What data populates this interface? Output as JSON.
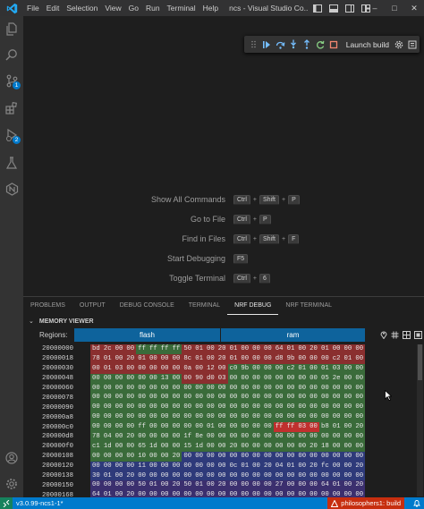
{
  "titlebar": {
    "menu": [
      "File",
      "Edit",
      "Selection",
      "View",
      "Go",
      "Run",
      "Terminal",
      "Help"
    ],
    "title": "ncs - Visual Studio Co...",
    "window_controls": [
      "minimize-icon",
      "maximize-icon",
      "close-icon"
    ]
  },
  "activity_bar": {
    "items": [
      {
        "name": "explorer",
        "icon": "files-icon"
      },
      {
        "name": "search",
        "icon": "search-icon"
      },
      {
        "name": "source-control",
        "icon": "source-control-icon",
        "badge": "1"
      },
      {
        "name": "extensions",
        "icon": "extensions-icon"
      },
      {
        "name": "run-debug",
        "icon": "run-debug-icon",
        "badge": "2"
      },
      {
        "name": "testing",
        "icon": "flask-icon"
      },
      {
        "name": "nrf-connect",
        "icon": "nrf-connect-icon"
      }
    ],
    "bottom": [
      {
        "name": "accounts",
        "icon": "account-icon"
      },
      {
        "name": "manage",
        "icon": "gear-icon"
      }
    ]
  },
  "debug_toolbar": {
    "buttons": [
      "continue-icon",
      "step-over-icon",
      "step-into-icon",
      "step-out-icon",
      "restart-icon",
      "stop-icon"
    ],
    "launch_config": "Launch build",
    "config_action_icons": [
      "gear-icon",
      "more-icon"
    ]
  },
  "shortcuts": [
    {
      "label": "Show All Commands",
      "keys": [
        "Ctrl",
        "Shift",
        "P"
      ]
    },
    {
      "label": "Go to File",
      "keys": [
        "Ctrl",
        "P"
      ]
    },
    {
      "label": "Find in Files",
      "keys": [
        "Ctrl",
        "Shift",
        "F"
      ]
    },
    {
      "label": "Start Debugging",
      "keys": [
        "F5"
      ]
    },
    {
      "label": "Toggle Terminal",
      "keys": [
        "Ctrl",
        "6"
      ]
    }
  ],
  "panel": {
    "tabs": [
      "PROBLEMS",
      "OUTPUT",
      "DEBUG CONSOLE",
      "TERMINAL",
      "NRF DEBUG",
      "NRF TERMINAL"
    ],
    "active_tab": "NRF DEBUG",
    "section_title": "MEMORY VIEWER",
    "regions_label": "Regions:",
    "regions": [
      "flash",
      "ram"
    ],
    "active_region": "ram"
  },
  "memory": {
    "rows": [
      {
        "addr": "20000000",
        "bytes": [
          "bd",
          "2c",
          "00",
          "00",
          "ff",
          "ff",
          "ff",
          "ff",
          "50",
          "01",
          "00",
          "20",
          "01",
          "00",
          "00",
          "00",
          "64",
          "01",
          "00",
          "20",
          "01",
          "00",
          "00",
          "00"
        ],
        "colors": "rrrrggggrrrrrrrrrrrrrrrr"
      },
      {
        "addr": "20000018",
        "bytes": [
          "78",
          "01",
          "00",
          "20",
          "01",
          "00",
          "00",
          "00",
          "8c",
          "01",
          "00",
          "20",
          "01",
          "00",
          "00",
          "00",
          "d8",
          "9b",
          "00",
          "00",
          "00",
          "c2",
          "01",
          "00"
        ],
        "colors": "rrrrrrrrrrrrrrrrrrrrrrrr"
      },
      {
        "addr": "20000030",
        "bytes": [
          "00",
          "01",
          "03",
          "00",
          "00",
          "00",
          "00",
          "00",
          "0a",
          "00",
          "12",
          "00",
          "c0",
          "9b",
          "00",
          "00",
          "00",
          "c2",
          "01",
          "00",
          "01",
          "03",
          "00",
          "00"
        ],
        "colors": "rrrrrrrrrrrrgggggggggggg"
      },
      {
        "addr": "20000048",
        "bytes": [
          "00",
          "00",
          "00",
          "00",
          "00",
          "00",
          "13",
          "00",
          "00",
          "90",
          "d0",
          "03",
          "00",
          "00",
          "00",
          "00",
          "00",
          "00",
          "00",
          "00",
          "05",
          "2e",
          "00",
          "00"
        ],
        "colors": "ggggggggrrrrgggggggggggg"
      },
      {
        "addr": "20000060",
        "bytes": [
          "00",
          "00",
          "00",
          "00",
          "00",
          "00",
          "00",
          "00",
          "00",
          "00",
          "00",
          "00",
          "00",
          "00",
          "00",
          "00",
          "00",
          "00",
          "00",
          "00",
          "00",
          "00",
          "00",
          "00"
        ],
        "colors": "gggggggggggggggggggggggg"
      },
      {
        "addr": "20000078",
        "bytes": [
          "00",
          "00",
          "00",
          "00",
          "00",
          "00",
          "00",
          "00",
          "00",
          "00",
          "00",
          "00",
          "00",
          "00",
          "00",
          "00",
          "00",
          "00",
          "00",
          "00",
          "00",
          "00",
          "00",
          "00"
        ],
        "colors": "gggggggggggggggggggggggg"
      },
      {
        "addr": "20000090",
        "bytes": [
          "00",
          "00",
          "00",
          "00",
          "00",
          "00",
          "00",
          "00",
          "00",
          "00",
          "00",
          "00",
          "00",
          "00",
          "00",
          "00",
          "00",
          "00",
          "00",
          "00",
          "00",
          "00",
          "00",
          "00"
        ],
        "colors": "gggggggggggggggggggggggg"
      },
      {
        "addr": "200000a8",
        "bytes": [
          "00",
          "00",
          "00",
          "00",
          "00",
          "00",
          "00",
          "00",
          "00",
          "00",
          "00",
          "00",
          "00",
          "00",
          "00",
          "00",
          "00",
          "00",
          "00",
          "00",
          "00",
          "00",
          "00",
          "00"
        ],
        "colors": "gggggggggggggggggggggggg"
      },
      {
        "addr": "200000c0",
        "bytes": [
          "00",
          "00",
          "00",
          "00",
          "ff",
          "00",
          "00",
          "00",
          "00",
          "00",
          "01",
          "00",
          "00",
          "00",
          "00",
          "00",
          "ff",
          "ff",
          "03",
          "00",
          "b8",
          "01",
          "00",
          "20"
        ],
        "colors": "gggggggggggggggghhhhgggg"
      },
      {
        "addr": "200000d8",
        "bytes": [
          "78",
          "04",
          "00",
          "20",
          "00",
          "00",
          "00",
          "00",
          "1f",
          "8e",
          "00",
          "00",
          "00",
          "00",
          "00",
          "00",
          "00",
          "00",
          "00",
          "00",
          "00",
          "00",
          "00",
          "00"
        ],
        "colors": "gggggggggggggggggggggggg"
      },
      {
        "addr": "200000f0",
        "bytes": [
          "c1",
          "1d",
          "00",
          "00",
          "65",
          "1d",
          "00",
          "00",
          "15",
          "1d",
          "00",
          "00",
          "20",
          "00",
          "00",
          "00",
          "00",
          "00",
          "00",
          "20",
          "18",
          "00",
          "00",
          "00"
        ],
        "colors": "gggggggggggggggggggggggg"
      },
      {
        "addr": "20000108",
        "bytes": [
          "00",
          "00",
          "00",
          "00",
          "10",
          "00",
          "00",
          "20",
          "00",
          "00",
          "00",
          "00",
          "00",
          "00",
          "00",
          "00",
          "00",
          "00",
          "00",
          "00",
          "00",
          "00",
          "00",
          "00"
        ],
        "colors": "ggggggggbbbbbbbbbbbbbbbb"
      },
      {
        "addr": "20000120",
        "bytes": [
          "00",
          "00",
          "00",
          "00",
          "11",
          "00",
          "00",
          "00",
          "00",
          "00",
          "00",
          "00",
          "0c",
          "01",
          "00",
          "20",
          "04",
          "01",
          "00",
          "20",
          "fc",
          "00",
          "00",
          "20"
        ],
        "colors": "bbbbbbbbbbbbbbbbbbbbbbbb"
      },
      {
        "addr": "20000138",
        "bytes": [
          "30",
          "01",
          "00",
          "20",
          "00",
          "00",
          "00",
          "00",
          "00",
          "00",
          "00",
          "00",
          "00",
          "00",
          "00",
          "00",
          "00",
          "00",
          "00",
          "00",
          "00",
          "00",
          "00",
          "00"
        ],
        "colors": "bbbbbbbbbbbbbbbbbbbbbbbb"
      },
      {
        "addr": "20000150",
        "bytes": [
          "00",
          "00",
          "00",
          "00",
          "50",
          "01",
          "00",
          "20",
          "50",
          "01",
          "00",
          "20",
          "00",
          "00",
          "00",
          "00",
          "27",
          "00",
          "00",
          "00",
          "64",
          "01",
          "00",
          "20"
        ],
        "colors": "pppppppppppppppppppppppp"
      },
      {
        "addr": "20000168",
        "bytes": [
          "64",
          "01",
          "00",
          "20",
          "00",
          "00",
          "00",
          "00",
          "00",
          "00",
          "00",
          "00",
          "00",
          "00",
          "00",
          "00",
          "00",
          "00",
          "00",
          "00",
          "00",
          "00",
          "00",
          "00"
        ],
        "colors": "pppppppppppppppppppppppp"
      }
    ]
  },
  "status_bar": {
    "version": "v3.0.99-ncs1-1*",
    "build": "philosophers1: build"
  },
  "colors": {
    "accent": "#007acc",
    "region_active": "#0e639c",
    "build_badge": "#c72e0f",
    "mem_red": "#8a2f2f",
    "mem_green": "#3a6b3a",
    "mem_blue": "#2e3a7a",
    "mem_purple": "#3b2f6e"
  }
}
